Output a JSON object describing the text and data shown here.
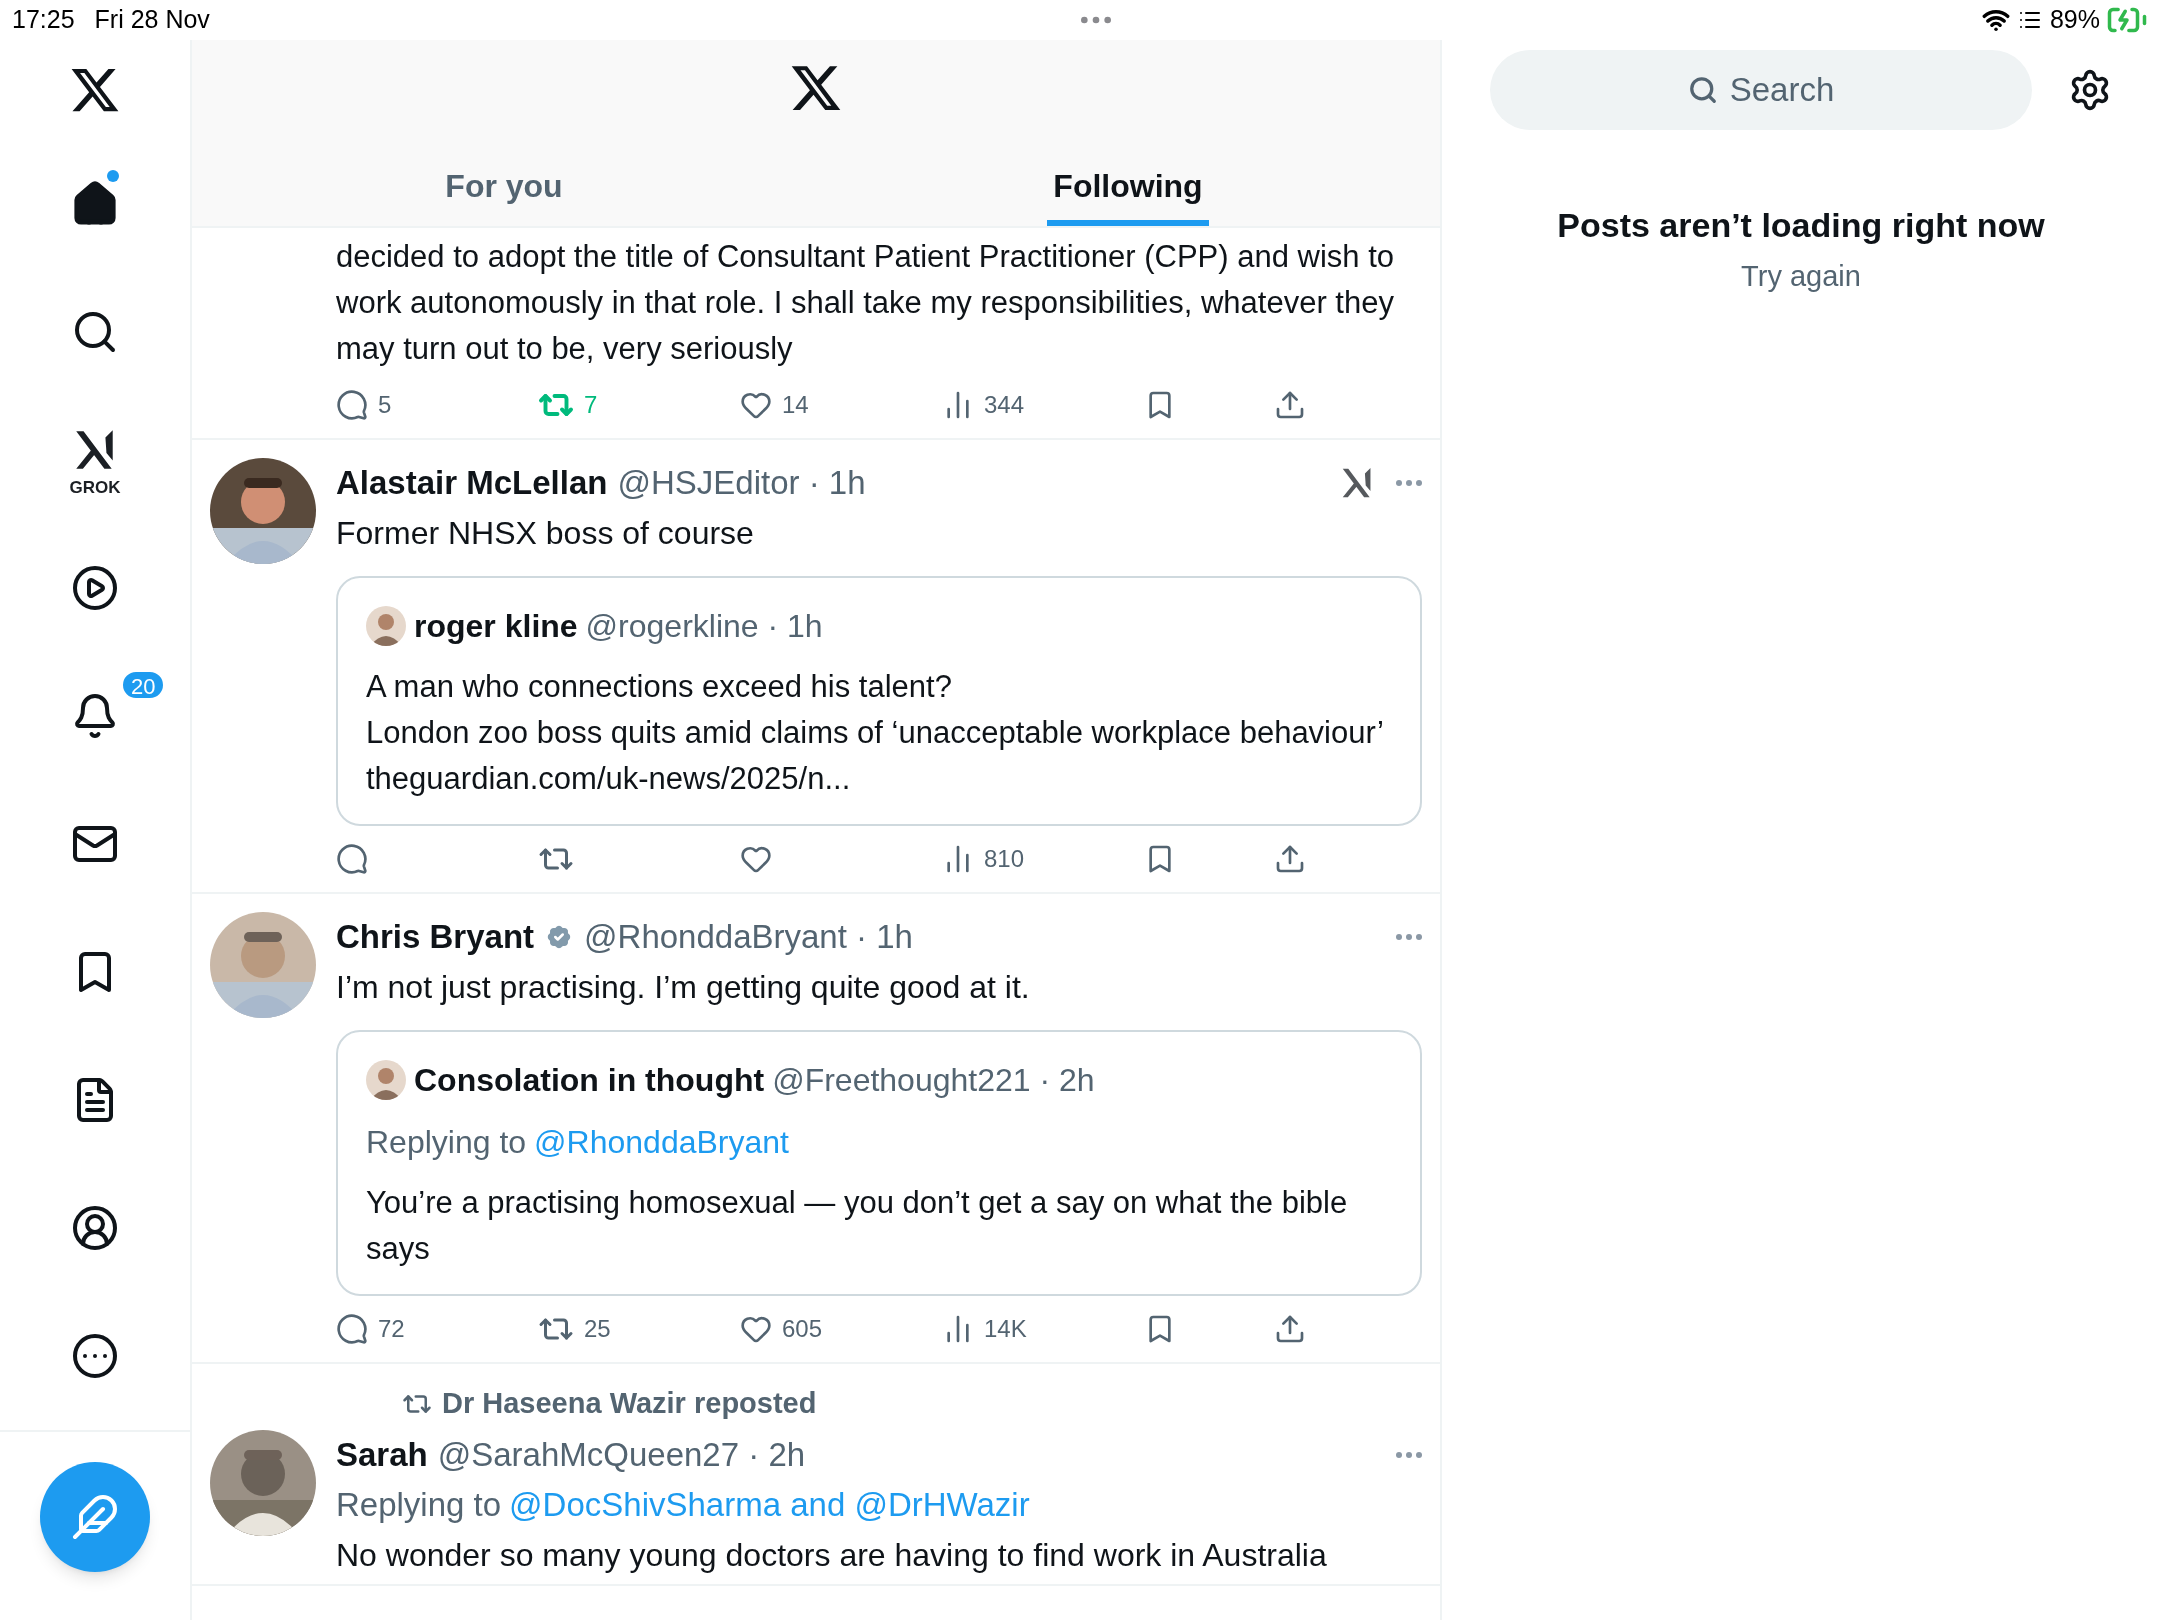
{
  "status_bar": {
    "time": "17:25",
    "date": "Fri 28 Nov",
    "battery": "89%"
  },
  "sidebar": {
    "items": [
      {
        "kind": "home",
        "selected": true,
        "has_new": true
      },
      {
        "kind": "search",
        "selected": false
      },
      {
        "kind": "grok",
        "selected": false,
        "label": "GROK"
      },
      {
        "kind": "video",
        "selected": false
      },
      {
        "kind": "notifications",
        "selected": false,
        "badge": "20"
      },
      {
        "kind": "messages",
        "selected": false
      },
      {
        "kind": "bookmarks",
        "selected": false
      },
      {
        "kind": "lists",
        "selected": false
      },
      {
        "kind": "profile",
        "selected": false
      },
      {
        "kind": "more",
        "selected": false
      }
    ]
  },
  "header": {
    "tabs": [
      {
        "label": "For you",
        "selected": false
      },
      {
        "label": "Following",
        "selected": true
      }
    ]
  },
  "posts": [
    {
      "text": "decided to adopt the title of Consultant Patient Practitioner (CPP) and wish to work autonomously in that role. I shall take my responsibilities, whatever they may turn out to be, very seriously",
      "actions": {
        "replies": "5",
        "reposts": "7",
        "reposted": true,
        "likes": "14",
        "views": "344"
      }
    },
    {
      "name": "Alastair McLellan",
      "byline": "@HSJEditor · 1h",
      "grok": true,
      "text": "Former NHSX boss of course",
      "quote": {
        "name": "roger kline",
        "byline": "@rogerkline · 1h",
        "lines": [
          "A man who connections exceed his talent?",
          "London zoo boss quits amid claims of ‘unacceptable workplace behaviour’ theguardian.com/uk-news/2025/n..."
        ]
      },
      "actions": {
        "views": "810",
        "reposted": false
      }
    },
    {
      "name": "Chris Bryant",
      "byline": "@RhonddaBryant · 1h",
      "verified": true,
      "text": "I’m not just practising. I’m getting quite good at it.",
      "quote": {
        "name": "Consolation in thought",
        "byline": "@Freethought221 · 2h",
        "replying_prefix": "Replying to",
        "replying_to": "@RhonddaBryant",
        "lines": [
          "You’re a practising homosexual — you don’t get a say on what the bible says"
        ]
      },
      "actions": {
        "replies": "72",
        "reposts": "25",
        "reposted": false,
        "likes": "605",
        "views": "14K"
      }
    },
    {
      "reposted_by": "Dr Haseena Wazir reposted",
      "name": "Sarah",
      "byline": "@SarahMcQueen27 · 2h",
      "replying_prefix": "Replying to",
      "replying_to": "@DocShivSharma and @DrHWazir",
      "text": "No wonder so many young doctors are having to find work in Australia"
    }
  ],
  "right_panel": {
    "search": {
      "placeholder": "Search"
    },
    "error": "Posts aren’t loading right now",
    "retry": "Try again"
  }
}
